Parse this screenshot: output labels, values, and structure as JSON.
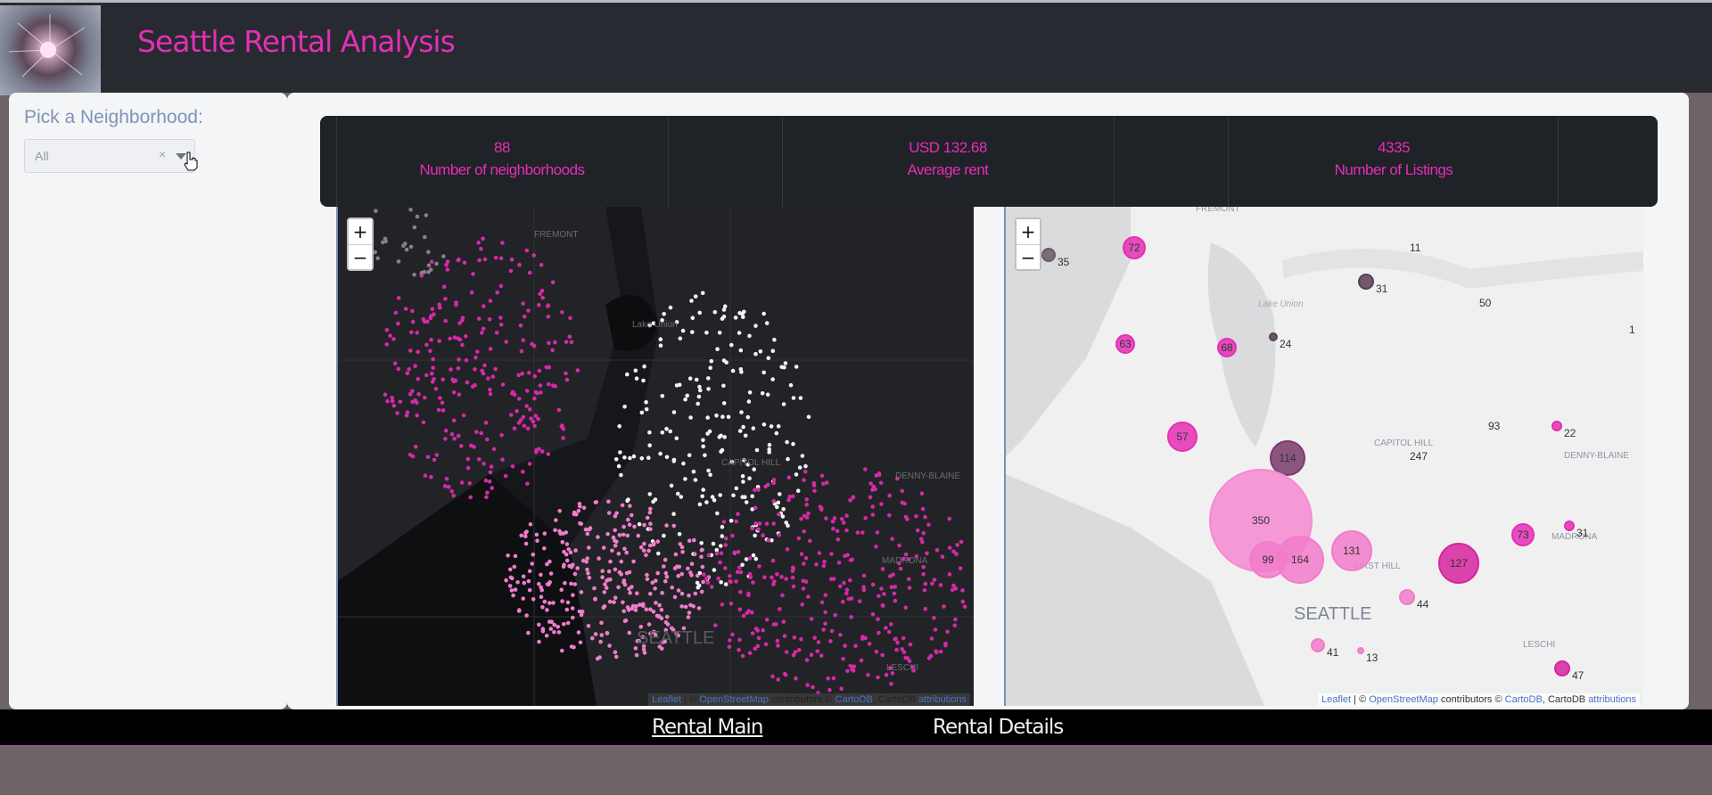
{
  "app": {
    "title": "Seattle Rental Analysis"
  },
  "sidebar": {
    "label": "Pick a Neighborhood:",
    "select": {
      "value": "All",
      "clear_glyph": "×",
      "icon": "chevron-down-icon"
    }
  },
  "kpis": [
    {
      "value": "88",
      "label": "Number of neighborhoods"
    },
    {
      "value": "USD 132.68",
      "label": "Average rent"
    },
    {
      "value": "4335",
      "label": "Number of Listings"
    }
  ],
  "map_dark": {
    "zoom_in": "+",
    "zoom_out": "−",
    "labels": {
      "fremont": "FREMONT",
      "lake_union": "Lake Union",
      "capitol_hill": "CAPITOL HILL",
      "denny_blaine": "DENNY-BLAINE",
      "madrona": "MADRONA",
      "seattle": "SEATTLE",
      "leschi": "LESCHI"
    },
    "attribution": {
      "leaflet": "Leaflet",
      "sep1": " | © ",
      "osm": "OpenStreetMap",
      "contrib": " contributors © ",
      "carto": "CartoDB",
      "sep2": ", CartoDB ",
      "attr": "attributions"
    }
  },
  "map_light": {
    "zoom_in": "+",
    "zoom_out": "−",
    "labels": {
      "fremont": "FREMONT",
      "lake_union": "Lake Union",
      "capitol_hill": "CAPITOL HILL",
      "denny_blaine": "DENNY-BLAINE",
      "madrona": "MADRONA",
      "first_hill": "FIRST HILL",
      "seattle": "SEATTLE",
      "leschi": "LESCHI"
    },
    "clusters": [
      {
        "label": "35",
        "color": "#6b5a66"
      },
      {
        "label": "72",
        "color": "#e52fb6"
      },
      {
        "label": "11",
        "color": ""
      },
      {
        "label": "31",
        "color": "#5a3f55"
      },
      {
        "label": "50",
        "color": ""
      },
      {
        "label": "1",
        "color": ""
      },
      {
        "label": "24",
        "color": "#5a3f55"
      },
      {
        "label": "63",
        "color": "#e52fb6"
      },
      {
        "label": "68",
        "color": "#e52fb6"
      },
      {
        "label": "57",
        "color": "#e52fb6"
      },
      {
        "label": "114",
        "color": "#7a3a6c"
      },
      {
        "label": "93",
        "color": ""
      },
      {
        "label": "22",
        "color": "#e52fb6"
      },
      {
        "label": "247",
        "color": ""
      },
      {
        "label": "350",
        "color": "#f58ad0"
      },
      {
        "label": "73",
        "color": "#e52fb6"
      },
      {
        "label": "31",
        "color": "#e52fb6"
      },
      {
        "label": "99",
        "color": "#f27bcb"
      },
      {
        "label": "164",
        "color": "#f27bcb"
      },
      {
        "label": "131",
        "color": "#f27bcb"
      },
      {
        "label": "127",
        "color": "#d6249f"
      },
      {
        "label": "44",
        "color": "#f27bcb"
      },
      {
        "label": "41",
        "color": "#f27bcb"
      },
      {
        "label": "13",
        "color": "#f27bcb"
      },
      {
        "label": "47",
        "color": "#d6249f"
      }
    ],
    "attribution": {
      "leaflet": "Leaflet",
      "sep1": " | © ",
      "osm": "OpenStreetMap",
      "contrib": " contributors © ",
      "carto": "CartoDB",
      "sep2": ", CartoDB ",
      "attr": "attributions"
    }
  },
  "nav": {
    "items": [
      "Rental Main",
      "Rental Details"
    ],
    "active": "Rental Main"
  },
  "colors": {
    "accent": "#e52fb6",
    "header_bg": "#272a30",
    "panel_bg": "#f4f5f7"
  }
}
